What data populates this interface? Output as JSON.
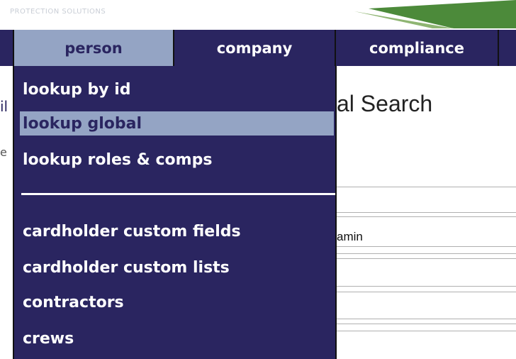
{
  "banner": {
    "brand_text": "PROTECTION SOLUTIONS"
  },
  "nav": {
    "tabs": [
      {
        "label": "person",
        "active": true
      },
      {
        "label": "company",
        "active": false
      },
      {
        "label": "compliance",
        "active": false
      }
    ]
  },
  "dropdown": {
    "items": [
      {
        "label": "lookup by id",
        "active": false
      },
      {
        "label": "lookup global",
        "active": true
      },
      {
        "label": "lookup roles & comps",
        "active": false
      },
      {
        "label": "cardholder custom fields",
        "active": false
      },
      {
        "label": "cardholder custom lists",
        "active": false
      },
      {
        "label": "contractors",
        "active": false
      },
      {
        "label": "crews",
        "active": false
      }
    ]
  },
  "page": {
    "title_fragment": "al Search",
    "left_fragment": "il",
    "left_fragment2": "e",
    "field_fragment": "amin"
  },
  "colors": {
    "nav_bg": "#2a2560",
    "active_bg": "#94a4c4",
    "banner_accent": "#4c8a3a"
  }
}
